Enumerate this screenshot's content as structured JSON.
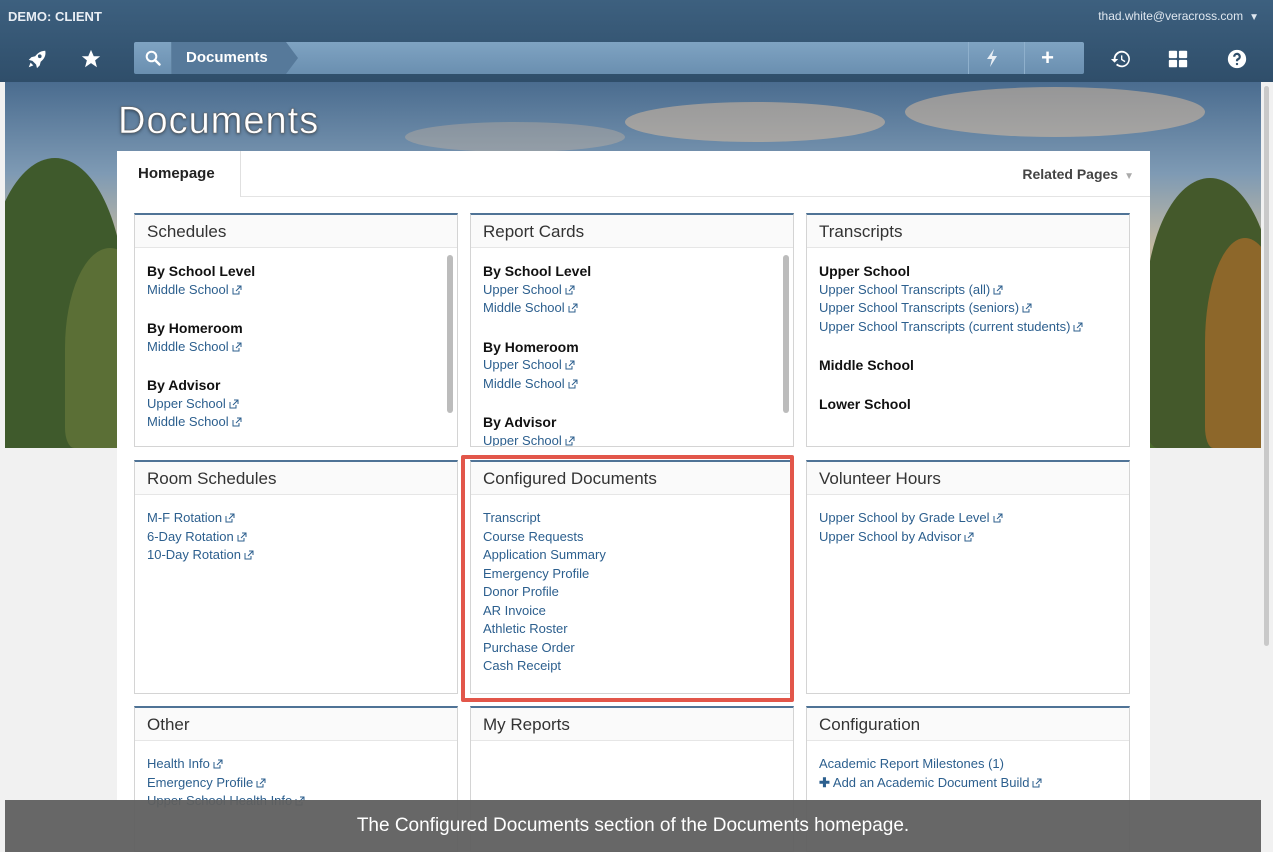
{
  "topbar": {
    "client": "DEMO: CLIENT",
    "user": "thad.white@veracross.com",
    "breadcrumb": "Documents"
  },
  "page": {
    "title": "Documents",
    "tab_home": "Homepage",
    "related_pages": "Related Pages"
  },
  "panels": {
    "schedules": {
      "title": "Schedules",
      "groups": [
        {
          "heading": "By School Level",
          "links": [
            "Middle School"
          ]
        },
        {
          "heading": "By Homeroom",
          "links": [
            "Middle School"
          ]
        },
        {
          "heading": "By Advisor",
          "links": [
            "Upper School",
            "Middle School"
          ]
        }
      ]
    },
    "report_cards": {
      "title": "Report Cards",
      "groups": [
        {
          "heading": "By School Level",
          "links": [
            "Upper School",
            "Middle School"
          ]
        },
        {
          "heading": "By Homeroom",
          "links": [
            "Upper School",
            "Middle School"
          ]
        },
        {
          "heading": "By Advisor",
          "links": [
            "Upper School"
          ]
        }
      ]
    },
    "transcripts": {
      "title": "Transcripts",
      "groups": [
        {
          "heading": "Upper School",
          "links": [
            "Upper School Transcripts (all)",
            "Upper School Transcripts (seniors)",
            "Upper School Transcripts (current students)"
          ]
        },
        {
          "heading": "Middle School",
          "links": []
        },
        {
          "heading": "Lower School",
          "links": []
        }
      ]
    },
    "room_schedules": {
      "title": "Room Schedules",
      "links": [
        "M-F Rotation",
        "6-Day Rotation",
        "10-Day Rotation"
      ]
    },
    "configured_documents": {
      "title": "Configured Documents",
      "links": [
        "Transcript",
        "Course Requests",
        "Application Summary",
        "Emergency Profile",
        "Donor Profile",
        "AR Invoice",
        "Athletic Roster",
        "Purchase Order",
        "Cash Receipt"
      ]
    },
    "volunteer_hours": {
      "title": "Volunteer Hours",
      "links": [
        "Upper School by Grade Level",
        "Upper School by Advisor"
      ]
    },
    "other": {
      "title": "Other",
      "links": [
        "Health Info",
        "Emergency Profile",
        "Upper School Health Info"
      ]
    },
    "my_reports": {
      "title": "My Reports"
    },
    "configuration": {
      "title": "Configuration",
      "milestones": "Academic Report Milestones",
      "milestones_count": "(1)",
      "add_build": "Add an Academic Document Build"
    }
  },
  "caption": "The Configured Documents section of the Documents homepage.",
  "colors": {
    "header": "#3d607f",
    "link": "#2c5f8e",
    "highlight": "#e2564a",
    "panel_top_border": "#4f7396"
  }
}
